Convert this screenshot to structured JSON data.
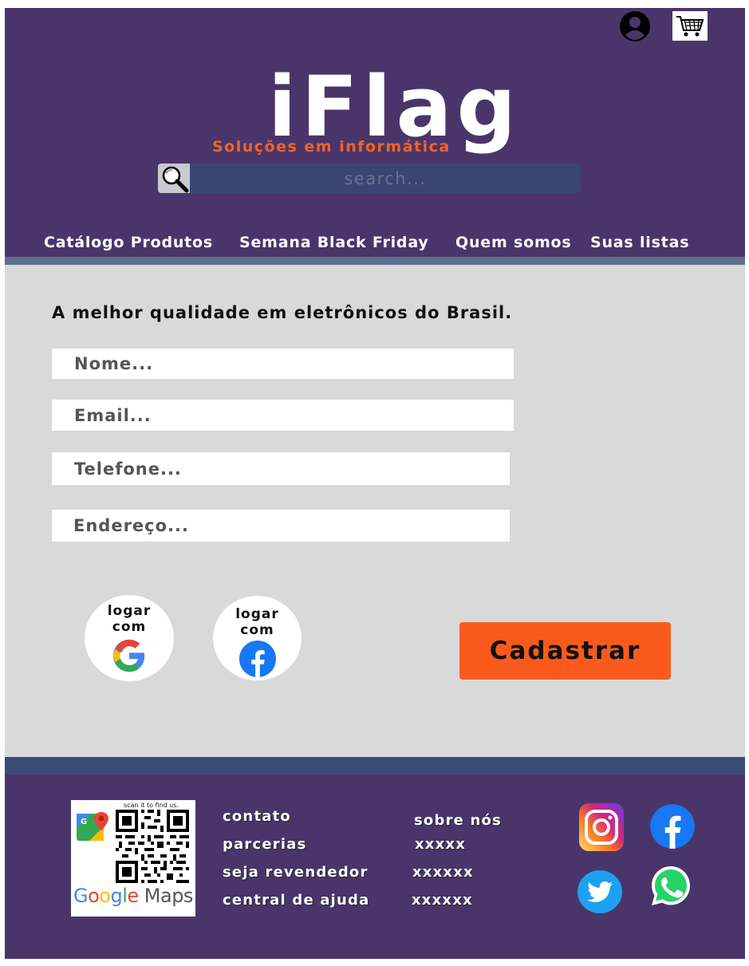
{
  "header": {
    "logo": "iFlag",
    "tagline": "Soluções em informática",
    "search_placeholder": "search..."
  },
  "nav": {
    "items": [
      "Catálogo Produtos",
      "Semana Black Friday",
      "Quem somos",
      "Suas listas"
    ]
  },
  "main": {
    "headline": "A melhor qualidade em eletrônicos do Brasil.",
    "fields": {
      "nome": "Nome...",
      "email": "Email...",
      "telefone": "Telefone...",
      "endereco": "Endereço..."
    },
    "login_google": "logar com",
    "login_facebook": "logar com",
    "submit_label": "Cadastrar"
  },
  "footer": {
    "qr_caption": "scan it to find us.",
    "maps_label": "Google Maps",
    "links_left": [
      "contato",
      "parcerias",
      "seja revendedor",
      "central de ajuda"
    ],
    "links_right": [
      "sobre nós",
      "xxxxx",
      "xxxxxx",
      "xxxxxx"
    ]
  },
  "colors": {
    "header_bg": "#4a356b",
    "accent": "#fa5b1d",
    "main_bg": "#d9d9d9"
  },
  "icons": [
    "user-icon",
    "cart-icon",
    "search-icon",
    "google-icon",
    "facebook-icon",
    "instagram-icon",
    "twitter-icon",
    "whatsapp-icon",
    "qr-code-icon",
    "google-maps-pin-icon"
  ]
}
